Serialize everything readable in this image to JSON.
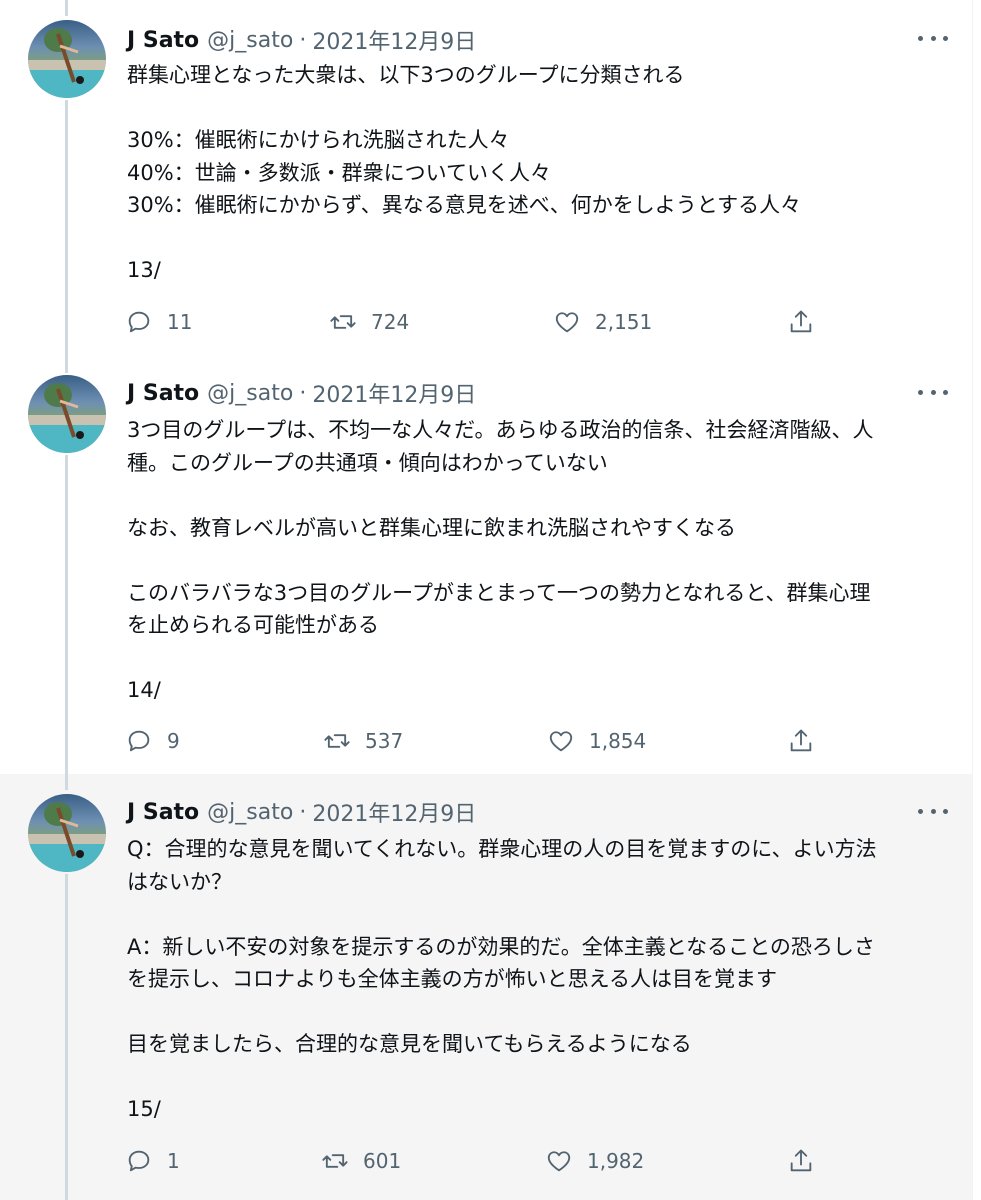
{
  "tweets": [
    {
      "name": "J Sato",
      "handle": "@j_sato",
      "separator": "·",
      "date": "2021年12月9日",
      "text": "群集心理となった大衆は、以下3つのグループに分類される\n\n30%：催眠術にかけられ洗脳された人々\n40%：世論・多数派・群衆についていく人々\n30%：催眠術にかからず、異なる意見を述べ、何かをしようとする人々\n\n13/",
      "replies": "11",
      "retweets": "724",
      "likes": "2,151"
    },
    {
      "name": "J Sato",
      "handle": "@j_sato",
      "separator": "·",
      "date": "2021年12月9日",
      "text": "3つ目のグループは、不均一な人々だ。あらゆる政治的信条、社会経済階級、人\n種。このグループの共通項・傾向はわかっていない\n\nなお、教育レベルが高いと群集心理に飲まれ洗脳されやすくなる\n\nこのバラバラな3つ目のグループがまとまって一つの勢力となれると、群集心理\nを止められる可能性がある\n\n14/",
      "replies": "9",
      "retweets": "537",
      "likes": "1,854"
    },
    {
      "name": "J Sato",
      "handle": "@j_sato",
      "separator": "·",
      "date": "2021年12月9日",
      "text": "Q：合理的な意見を聞いてくれない。群衆心理の人の目を覚ますのに、よい方法\nはないか？\n\nA：新しい不安の対象を提示するのが効果的だ。全体主義となることの恐ろしさ\nを提示し、コロナよりも全体主義の方が怖いと思える人は目を覚ます\n\n目を覚ましたら、合理的な意見を聞いてもらえるようになる\n\n15/",
      "replies": "1",
      "retweets": "601",
      "likes": "1,982"
    }
  ],
  "icons": {
    "reply": "reply-icon",
    "retweet": "retweet-icon",
    "like": "heart-icon",
    "share": "share-icon",
    "more": "more-icon"
  },
  "colors": {
    "text": "#0f1419",
    "secondary": "#536471",
    "thread_line": "#cfd9de",
    "highlight_bg": "#f5f5f5"
  }
}
